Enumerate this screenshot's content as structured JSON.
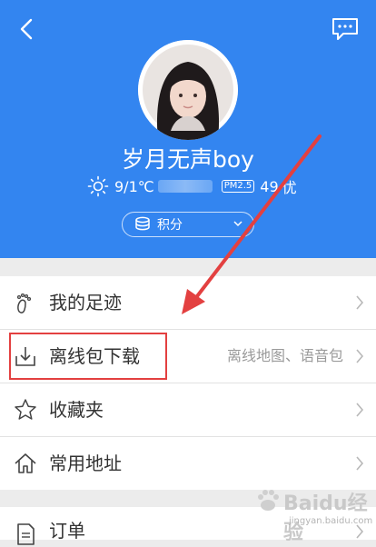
{
  "header": {
    "username": "岁月无声boy",
    "weather": {
      "temperature": "9/1℃",
      "pm_badge": "PM2.5",
      "aqi_value": "49",
      "aqi_level": "优"
    },
    "points_label": "积分",
    "background_color": "#3385f0"
  },
  "menu": {
    "items": [
      {
        "icon": "footprint-icon",
        "label": "我的足迹",
        "sub": ""
      },
      {
        "icon": "download-icon",
        "label": "离线包下载",
        "sub": "离线地图、语音包"
      },
      {
        "icon": "star-icon",
        "label": "收藏夹",
        "sub": ""
      },
      {
        "icon": "home-icon",
        "label": "常用地址",
        "sub": ""
      }
    ],
    "orders": {
      "icon": "document-icon",
      "label": "订单"
    }
  },
  "annotation": {
    "highlight_color": "#e34040"
  },
  "watermark": {
    "title": "Baidu经验",
    "subtitle": "jingyan.baidu.com"
  }
}
